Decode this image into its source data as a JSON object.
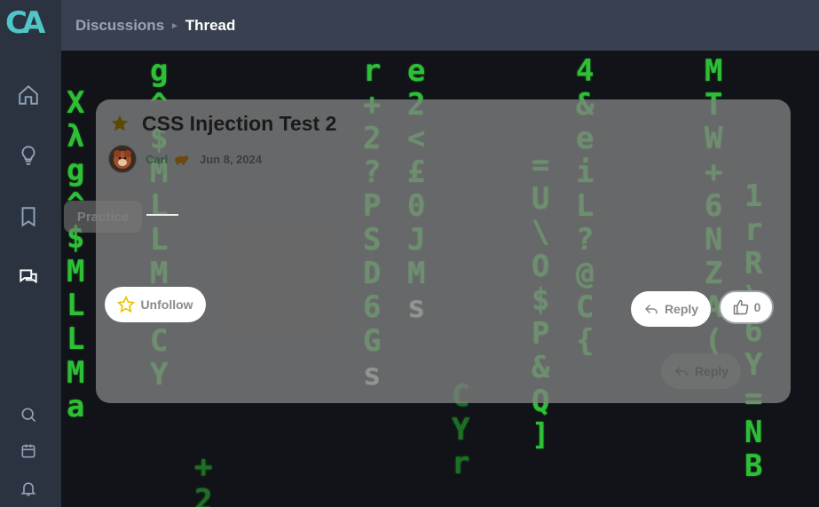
{
  "app": {
    "logo_text": "CA",
    "accent": "#4fc7c7"
  },
  "sidebar": {
    "items": [
      {
        "name": "home",
        "icon": "home-icon"
      },
      {
        "name": "ideas",
        "icon": "lightbulb-icon"
      },
      {
        "name": "bookmarks",
        "icon": "bookmark-icon"
      },
      {
        "name": "discussions",
        "icon": "chat-icon",
        "active": true
      },
      {
        "name": "search",
        "icon": "search-icon"
      },
      {
        "name": "calendar",
        "icon": "calendar-icon"
      },
      {
        "name": "notifications",
        "icon": "bell-icon"
      }
    ]
  },
  "breadcrumb": {
    "root": "Discussions",
    "separator": "▸",
    "current": "Thread"
  },
  "thread": {
    "title": "CSS Injection Test 2",
    "author": "Carl",
    "date": "Jun 8, 2024",
    "tag": "Practice",
    "unfollow_label": "Unfollow",
    "reply_label": "Reply",
    "like_count": "0",
    "ghost_reply_label": "Reply"
  },
  "background": {
    "rain_glyphs": [
      "g",
      "^",
      "$",
      "M",
      "L",
      "L",
      "M",
      "a",
      "C",
      "Y",
      "r",
      "+",
      "2",
      "?",
      "P",
      "S",
      "D",
      "6",
      "G",
      "s",
      "e",
      "2",
      "<",
      "£",
      "0",
      "J",
      "M",
      "s",
      "4",
      "&",
      "e",
      "i",
      "L",
      "?",
      "@",
      "C",
      "{",
      "=",
      "U",
      "\\",
      "O",
      "$",
      "P",
      "&",
      "Q",
      "]",
      "M",
      "T",
      "W",
      "+",
      "6",
      "N",
      "Z",
      "A",
      "(",
      "1",
      "r",
      "R",
      "\\",
      "6",
      "Y",
      "=",
      "N",
      "B",
      "X",
      "λ"
    ]
  }
}
